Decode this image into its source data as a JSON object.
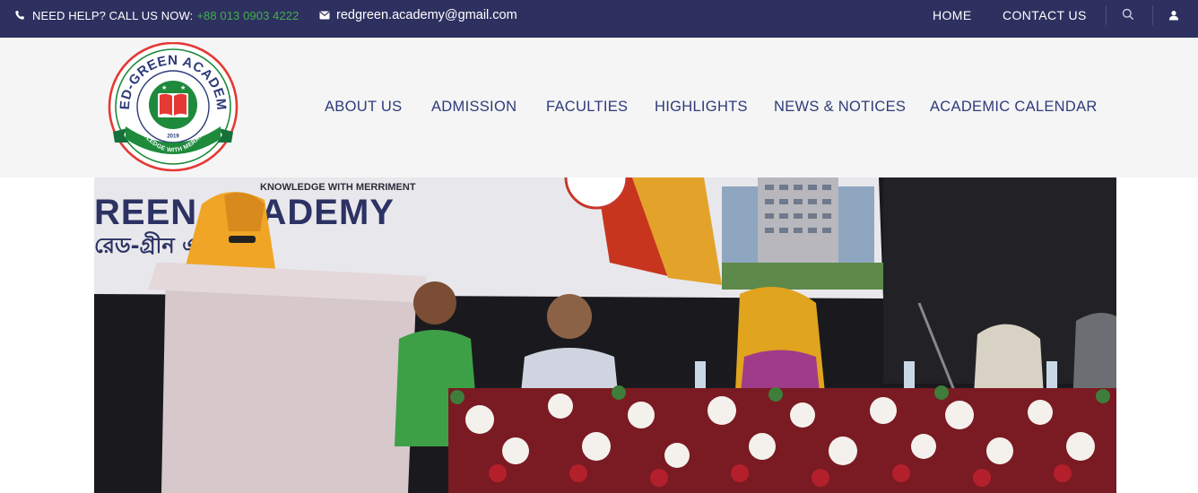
{
  "topbar": {
    "help_prefix": "NEED HELP? CALL US NOW:",
    "phone": "+88 013 0903 4222",
    "email": "redgreen.academy@gmail.com",
    "nav": {
      "home": "HOME",
      "contact": "CONTACT US"
    },
    "icons": {
      "phone": "phone-icon",
      "mail": "mail-icon",
      "search": "search-icon",
      "user": "user-icon"
    }
  },
  "logo": {
    "name": "RED-GREEN ACADEMY",
    "tagline": "KNOWLEDGE WITH MERRIMENT",
    "year": "2019"
  },
  "nav": {
    "items": [
      {
        "label": "ABOUT US"
      },
      {
        "label": "ADMISSION"
      },
      {
        "label": "FACULTIES"
      },
      {
        "label": "HIGHLIGHTS"
      },
      {
        "label": "NEWS & NOTICES"
      },
      {
        "label": "ACADEMIC CALENDAR"
      }
    ]
  },
  "hero": {
    "banner_tagline": "KNOWLEDGE WITH MERRIMENT",
    "banner_name": "REEN ACADEMY",
    "banner_bangla": "রেড-গ্রীন একাডেমি"
  },
  "colors": {
    "topbar_bg": "#2e3060",
    "accent_green": "#43b049",
    "nav_text": "#2e3a7a",
    "header_bg": "#f5f5f5",
    "logo_red": "#e53935",
    "logo_green": "#1e8a3c"
  }
}
